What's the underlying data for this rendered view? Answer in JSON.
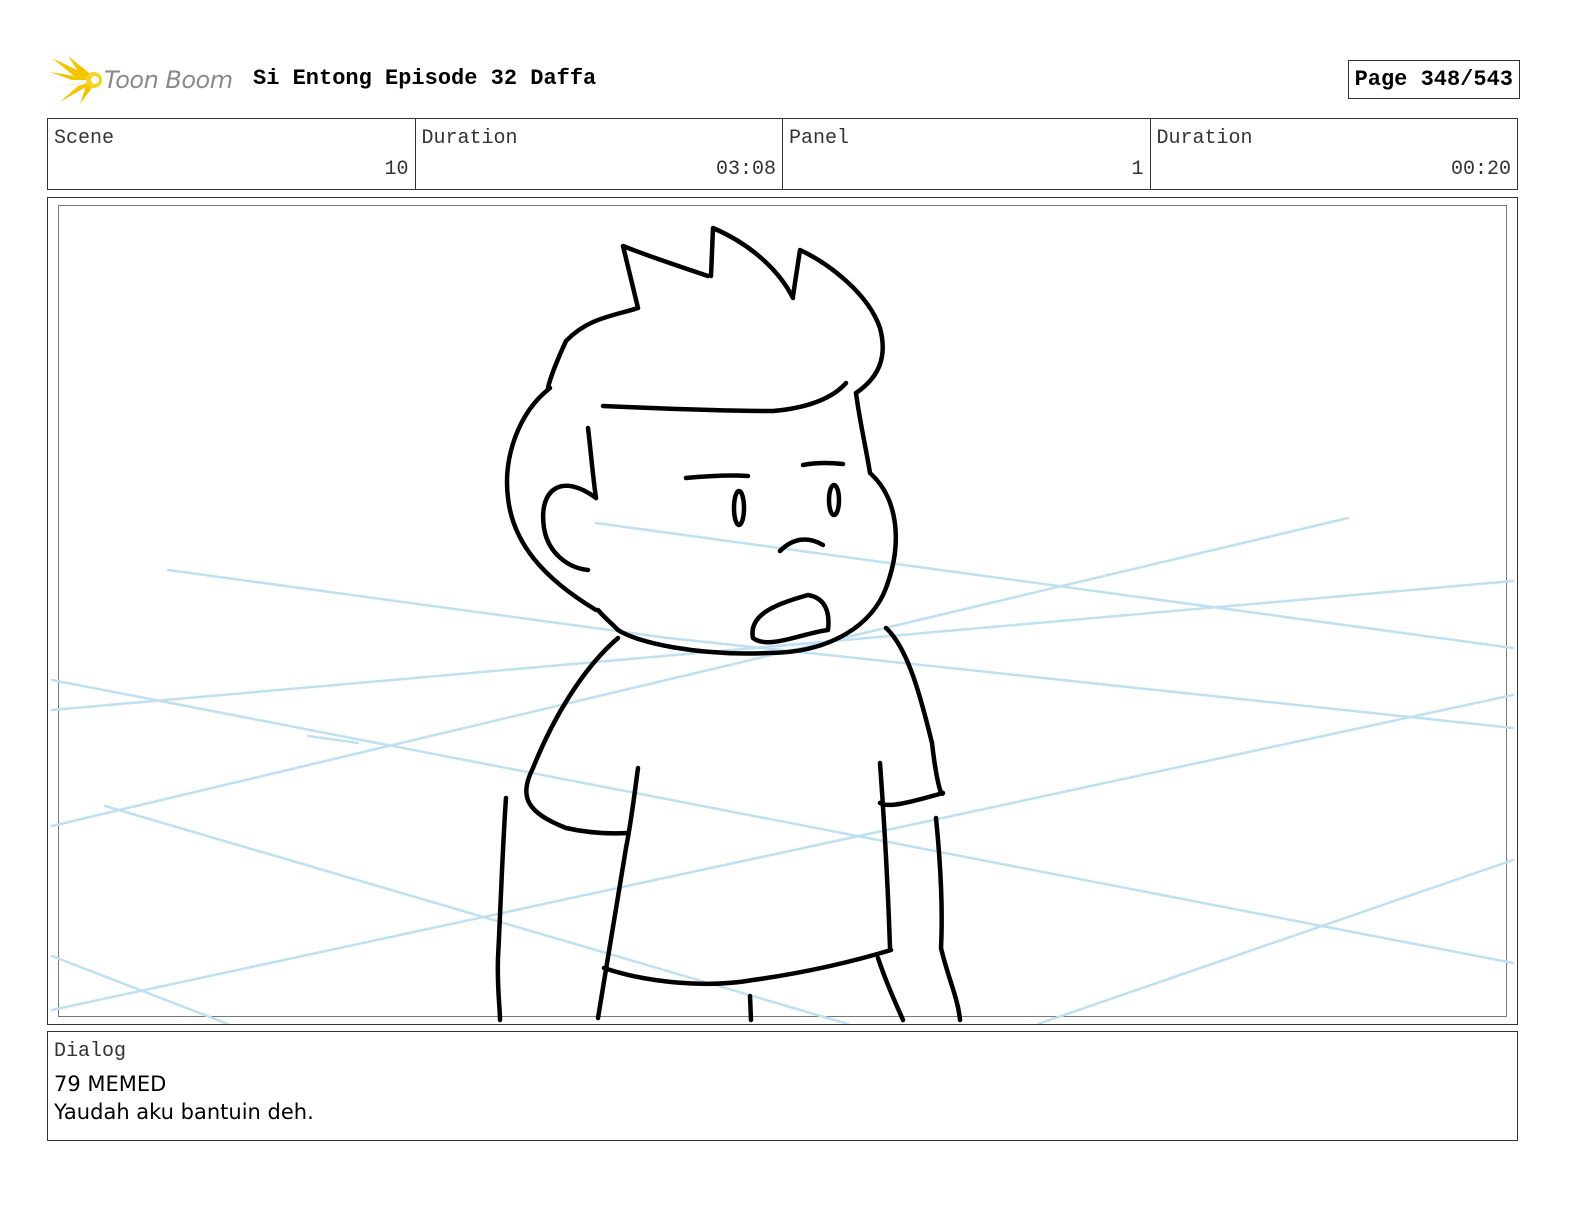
{
  "header": {
    "logo_text": "Toon Boom",
    "title": "Si Entong Episode 32 Daffa",
    "page": "Page 348/543"
  },
  "info": {
    "scene_label": "Scene",
    "scene_value": "10",
    "scene_duration_label": "Duration",
    "scene_duration_value": "03:08",
    "panel_label": "Panel",
    "panel_value": "1",
    "panel_duration_label": "Duration",
    "panel_duration_value": "00:20"
  },
  "panel": {
    "image_icon": "storyboard-sketch-icon",
    "guide_color": "#bfe0f2",
    "ink_color": "#000000"
  },
  "dialog": {
    "label": "Dialog",
    "speaker": "79 MEMED",
    "line": "Yaudah aku bantuin deh."
  },
  "colors": {
    "logo_burst": "#f5c400",
    "logo_text": "#8a8a8a",
    "border": "#333333"
  }
}
